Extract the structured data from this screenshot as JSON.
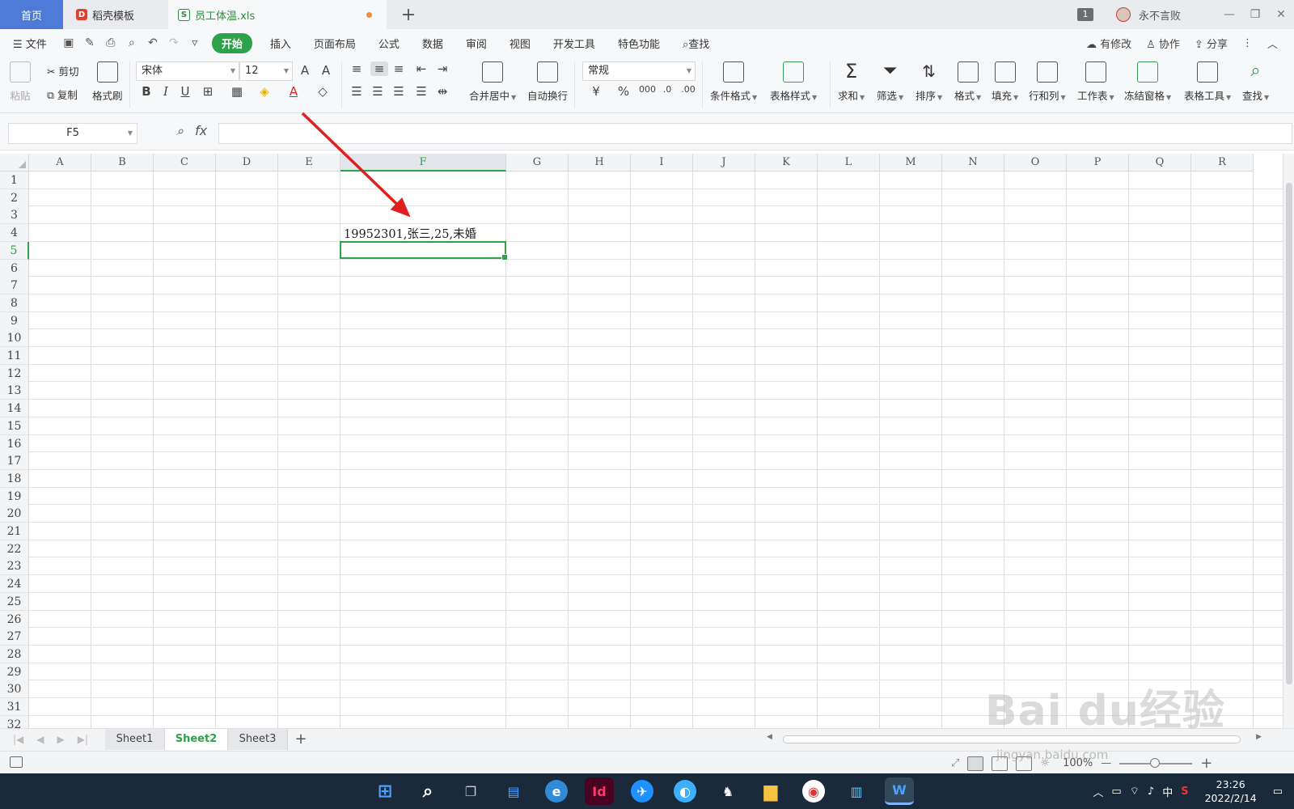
{
  "tabs": {
    "home": "首页",
    "templates": "稻壳模板",
    "file": "员工体温.xls",
    "add": "+"
  },
  "titlebar": {
    "window_count": "1",
    "user_name": "永不言败",
    "minimize": "—",
    "restore": "❐",
    "close": "✕"
  },
  "menu": {
    "file": "文件",
    "items": [
      "开始",
      "插入",
      "页面布局",
      "公式",
      "数据",
      "审阅",
      "视图",
      "开发工具",
      "特色功能"
    ],
    "search": "查找",
    "right": [
      "有修改",
      "协作",
      "分享"
    ]
  },
  "ribbon": {
    "paste": "粘贴",
    "cut": "剪切",
    "copy": "复制",
    "format_painter": "格式刷",
    "font_name": "宋体",
    "font_size": "12",
    "merge_center": "合并居中",
    "auto_wrap": "自动换行",
    "number_format": "常规",
    "cond_format": "条件格式",
    "table_style": "表格样式",
    "sum": "求和",
    "filter": "筛选",
    "sort": "排序",
    "format": "格式",
    "fill": "填充",
    "row_col": "行和列",
    "worksheet": "工作表",
    "freeze": "冻结窗格",
    "table_tools": "表格工具",
    "find": "查找"
  },
  "formula_bar": {
    "name_box": "F5",
    "fx": "fx",
    "value": ""
  },
  "grid": {
    "columns": [
      "A",
      "B",
      "C",
      "D",
      "E",
      "F",
      "G",
      "H",
      "I",
      "J",
      "K",
      "L",
      "M",
      "N",
      "O",
      "P",
      "Q",
      "R"
    ],
    "rows": [
      "1",
      "2",
      "3",
      "4",
      "5",
      "6",
      "7",
      "8",
      "9",
      "10",
      "11",
      "12",
      "13",
      "14",
      "15",
      "16",
      "17",
      "18",
      "19",
      "20",
      "21",
      "22",
      "23",
      "24",
      "25",
      "26",
      "27",
      "28",
      "29",
      "30",
      "31",
      "32"
    ],
    "active_cell": "F5",
    "cell_F4": "19952301,张三,25,未婚"
  },
  "sheets": [
    "Sheet1",
    "Sheet2",
    "Sheet3"
  ],
  "active_sheet": "Sheet2",
  "status": {
    "zoom": "100%"
  },
  "taskbar": {
    "ime": "中",
    "time": "23:26",
    "date": "2022/2/14"
  },
  "watermark": {
    "brand": "Bai du经验",
    "url": "jingyan.baidu.com"
  },
  "colors": {
    "accent": "#2ea24a",
    "home_tab": "#4f7bd8",
    "arrow": "#e02020"
  }
}
